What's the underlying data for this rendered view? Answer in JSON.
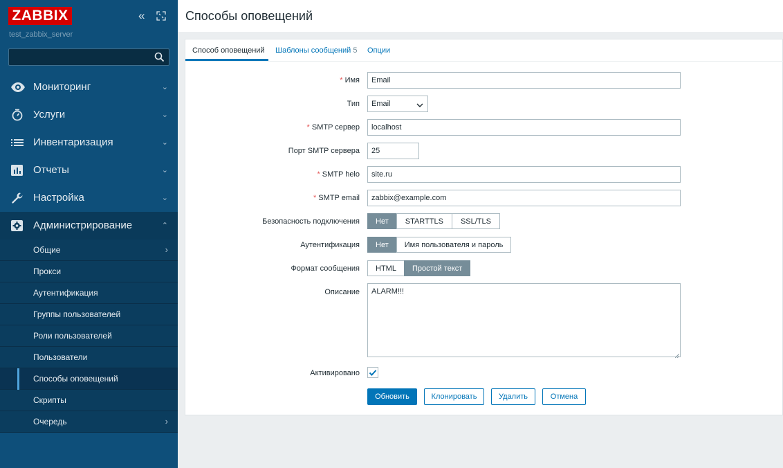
{
  "app": {
    "logo_text": "ZABBIX",
    "server_name": "test_zabbix_server",
    "search_placeholder": ""
  },
  "menu": [
    {
      "label": "Мониторинг",
      "icon": "eye-icon"
    },
    {
      "label": "Услуги",
      "icon": "clock-icon"
    },
    {
      "label": "Инвентаризация",
      "icon": "list-icon"
    },
    {
      "label": "Отчеты",
      "icon": "bar-chart-icon"
    },
    {
      "label": "Настройка",
      "icon": "wrench-icon"
    },
    {
      "label": "Администрирование",
      "icon": "gear-icon"
    }
  ],
  "submenu": [
    {
      "label": "Общие",
      "has_arrow": true
    },
    {
      "label": "Прокси"
    },
    {
      "label": "Аутентификация"
    },
    {
      "label": "Группы пользователей"
    },
    {
      "label": "Роли пользователей"
    },
    {
      "label": "Пользователи"
    },
    {
      "label": "Способы оповещений",
      "selected": true
    },
    {
      "label": "Скрипты"
    },
    {
      "label": "Очередь",
      "has_arrow": true
    }
  ],
  "page": {
    "title": "Способы оповещений"
  },
  "tabs": [
    {
      "label": "Способ оповещений",
      "active": true
    },
    {
      "label": "Шаблоны сообщений",
      "count": "5"
    },
    {
      "label": "Опции"
    }
  ],
  "form": {
    "name": {
      "label": "Имя",
      "required": "*",
      "value": "Email"
    },
    "type": {
      "label": "Тип",
      "value": "Email"
    },
    "smtp_server": {
      "label": "SMTP сервер",
      "required": "*",
      "value": "localhost"
    },
    "smtp_port": {
      "label": "Порт SMTP сервера",
      "value": "25"
    },
    "smtp_helo": {
      "label": "SMTP helo",
      "required": "*",
      "value": "site.ru"
    },
    "smtp_email": {
      "label": "SMTP email",
      "required": "*",
      "value": "zabbix@example.com"
    },
    "security": {
      "label": "Безопасность подключения",
      "options": [
        "Нет",
        "STARTTLS",
        "SSL/TLS"
      ],
      "selected": "Нет"
    },
    "auth": {
      "label": "Аутентификация",
      "options": [
        "Нет",
        "Имя пользователя и пароль"
      ],
      "selected": "Нет"
    },
    "format": {
      "label": "Формат сообщения",
      "options": [
        "HTML",
        "Простой текст"
      ],
      "selected": "Простой текст"
    },
    "description": {
      "label": "Описание",
      "value": "ALARM!!!"
    },
    "enabled": {
      "label": "Активировано",
      "checked": true
    }
  },
  "buttons": {
    "update": "Обновить",
    "clone": "Клонировать",
    "delete": "Удалить",
    "cancel": "Отмена"
  },
  "colors": {
    "sidebar": "#0e4f7a",
    "accent": "#0275b8",
    "logo": "#d40000",
    "required": "#e45959"
  }
}
